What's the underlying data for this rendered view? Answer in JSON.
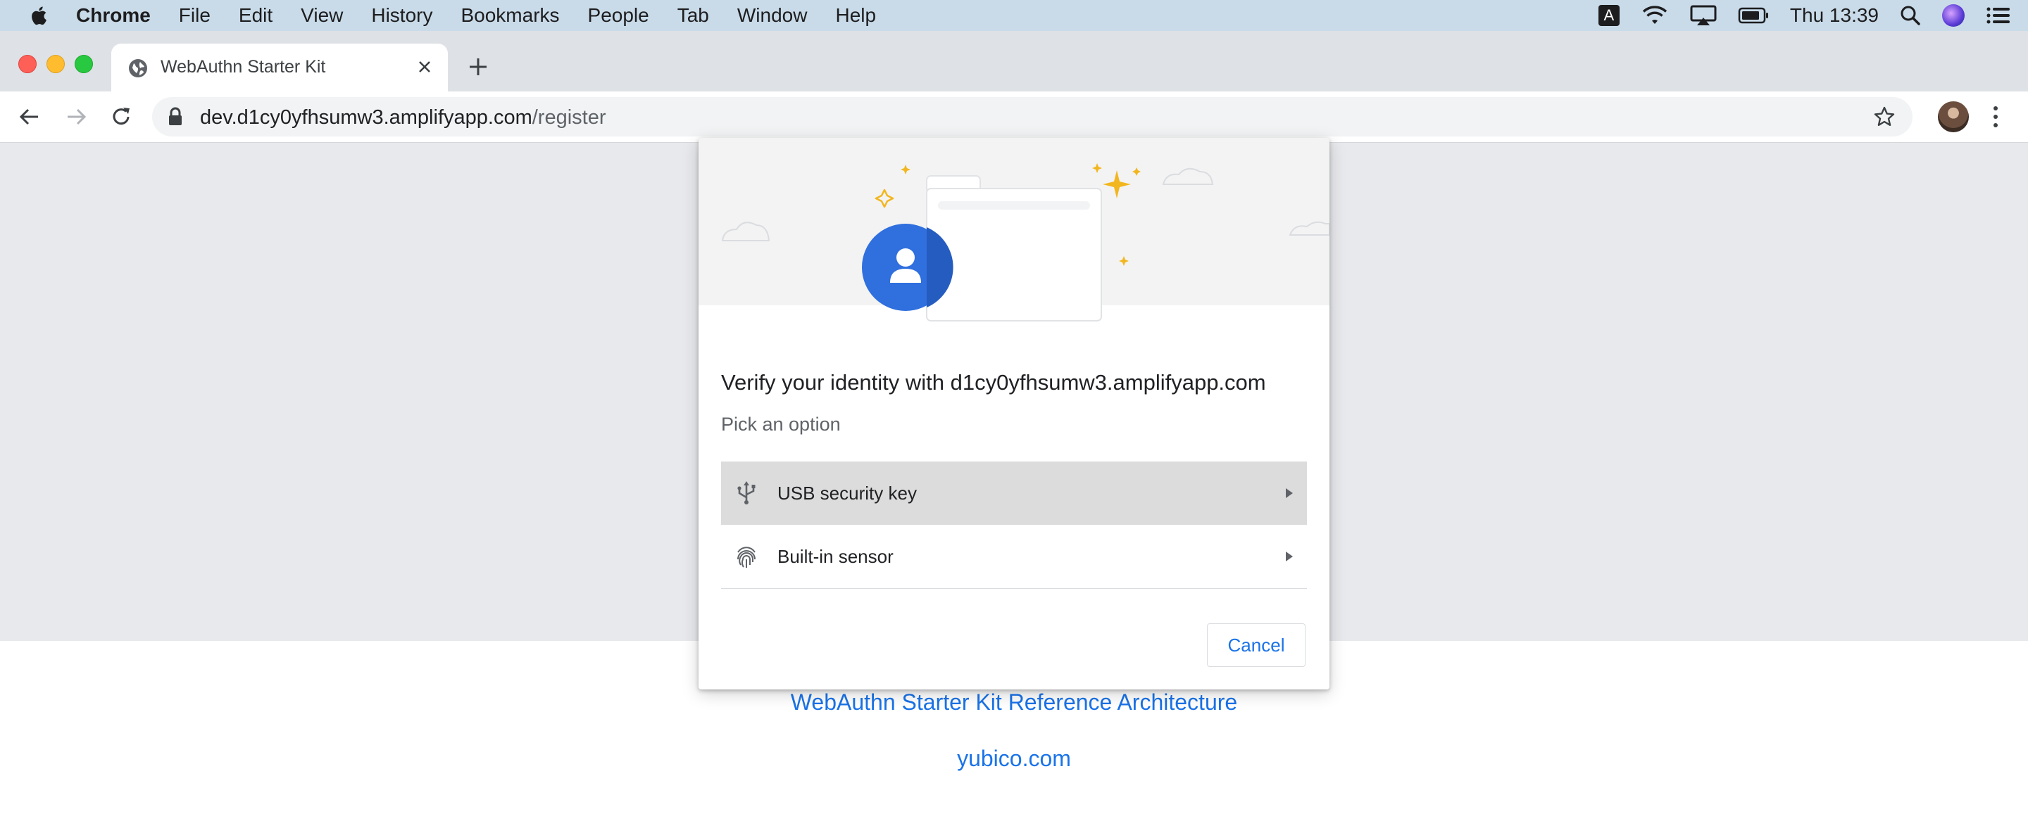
{
  "menubar": {
    "app_name": "Chrome",
    "menus": [
      "File",
      "Edit",
      "View",
      "History",
      "Bookmarks",
      "People",
      "Tab",
      "Window",
      "Help"
    ],
    "input_source": "A",
    "clock": "Thu 13:39",
    "icons": [
      "apple-icon",
      "wifi-icon",
      "airplay-icon",
      "battery-icon",
      "spotlight-icon",
      "siri-icon",
      "control-center-icon"
    ]
  },
  "tab": {
    "title": "WebAuthn Starter Kit",
    "favicon": "globe-icon"
  },
  "omnibox": {
    "host": "dev.d1cy0yfhsumw3.amplifyapp.com",
    "path": "/register"
  },
  "dialog": {
    "title": "Verify your identity with d1cy0yfhsumw3.amplifyapp.com",
    "subtitle": "Pick an option",
    "options": [
      {
        "label": "USB security key",
        "icon": "usb-icon",
        "selected": true
      },
      {
        "label": "Built-in sensor",
        "icon": "fingerprint-icon",
        "selected": false
      }
    ],
    "cancel_label": "Cancel"
  },
  "page": {
    "links": [
      "WebAuthn Starter Kit Reference Architecture",
      "yubico.com"
    ]
  },
  "colors": {
    "menubar_bg": "#c9dbe9",
    "tabstrip_bg": "#dee1e6",
    "page_gray": "#e8e9ec",
    "link_blue": "#1a73e8",
    "avatar_blue": "#2f6fde",
    "sparkle_gold": "#f2b61f"
  }
}
